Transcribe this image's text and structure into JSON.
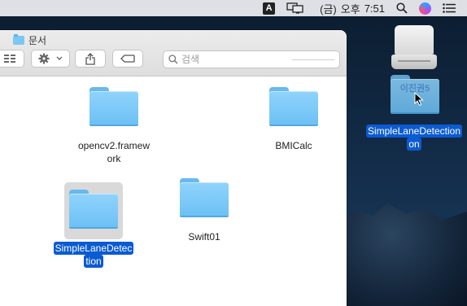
{
  "menubar": {
    "input_source": "A",
    "clock": {
      "day": "(금)",
      "ampm": "오후",
      "time": "7:51"
    }
  },
  "finder": {
    "title": "문서",
    "search_placeholder": "검색",
    "items": [
      {
        "name": "opencv2.framework",
        "line1": "opencv2.framew",
        "line2": "ork"
      },
      {
        "name": "BMICalc"
      },
      {
        "name": "SimpleLaneDetection",
        "line1": "SimpleLaneDetec",
        "line2": "tion",
        "selected": true
      },
      {
        "name": "Swift01"
      }
    ]
  },
  "desktop": {
    "drag_ghost_text": "이진권5",
    "selected_label_line1": "SimpleLaneDetection",
    "selected_label_line2": "on"
  },
  "colors": {
    "selection_blue": "#0b5bd2",
    "folder_blue": "#7cc7f3"
  }
}
